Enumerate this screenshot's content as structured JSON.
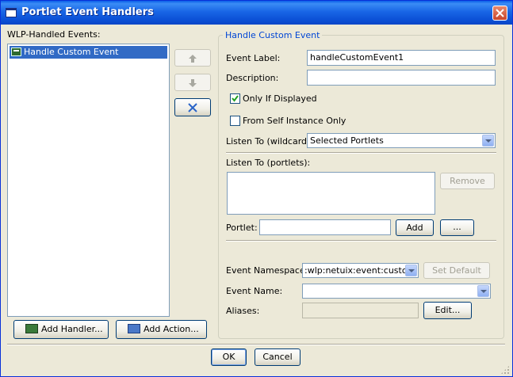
{
  "window": {
    "title": "Portlet Event Handlers"
  },
  "left": {
    "events_label": "WLP-Handled Events:",
    "events": [
      {
        "label": "Handle Custom Event"
      }
    ],
    "add_handler_label": "Add Handler...",
    "add_action_label": "Add Action..."
  },
  "group": {
    "title": "Handle Custom Event",
    "event_label_label": "Event Label:",
    "event_label_value": "handleCustomEvent1",
    "description_label": "Description:",
    "description_value": "",
    "only_if_displayed_label": "Only If Displayed",
    "only_if_displayed_checked": true,
    "from_self_label": "From Self Instance Only",
    "from_self_checked": false,
    "listen_wildcard_label": "Listen To (wildcard):",
    "listen_wildcard_value": "Selected Portlets",
    "listen_portlets_label": "Listen To (portlets):",
    "remove_label": "Remove",
    "portlet_label": "Portlet:",
    "portlet_value": "",
    "add_label": "Add",
    "browse_label": "...",
    "namespace_label": "Event Namespace:",
    "namespace_value": ":wlp:netuix:event:custom",
    "set_default_label": "Set Default",
    "event_name_label": "Event Name:",
    "event_name_value": "",
    "aliases_label": "Aliases:",
    "aliases_value": "",
    "edit_label": "Edit..."
  },
  "footer": {
    "ok_label": "OK",
    "cancel_label": "Cancel"
  },
  "colors": {
    "title_bar": "#0a5ee8",
    "selection": "#316ac5",
    "group_title": "#0046d5"
  }
}
